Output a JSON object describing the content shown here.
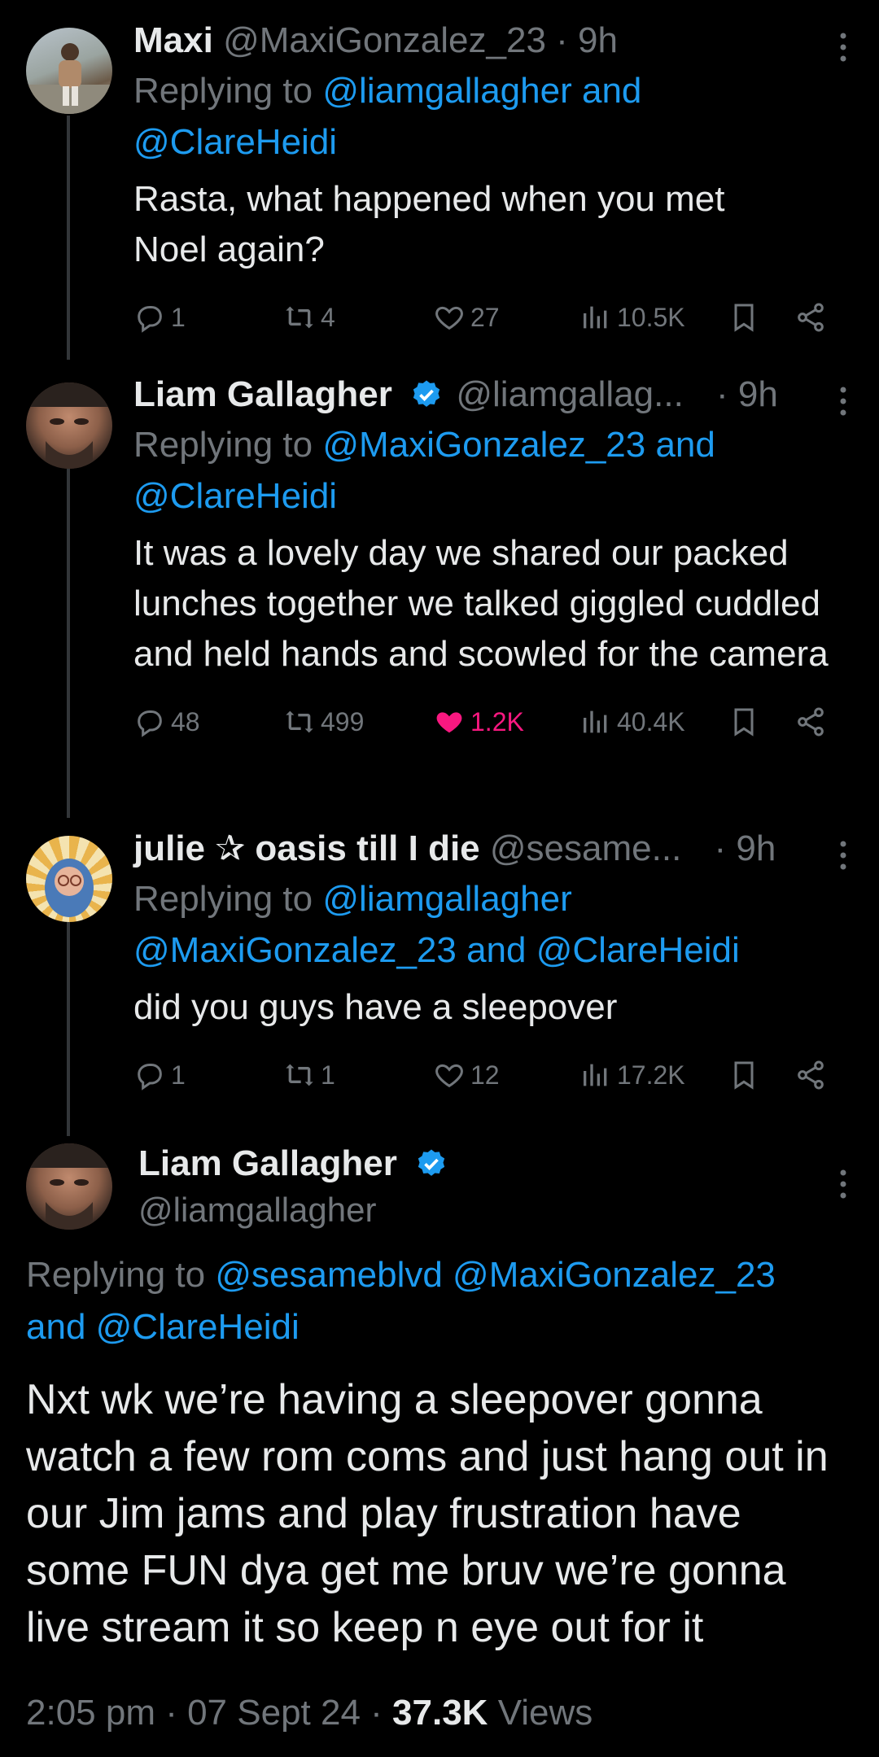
{
  "tweets": [
    {
      "name": "Maxi",
      "handle": "@MaxiGonzalez_23",
      "time": "· 9h",
      "reply_prefix": "Replying to",
      "reply_line1": "@liamgallagher and",
      "reply_line2": "@ClareHeidi",
      "text": "Rasta, what happened when you met Noel again?",
      "replies": "1",
      "retweets": "4",
      "likes": "27",
      "views": "10.5K"
    },
    {
      "name": "Liam Gallagher",
      "handle": "@liamgallag...",
      "time": "· 9h",
      "reply_prefix": "Replying to",
      "reply_line1": "@MaxiGonzalez_23 and",
      "reply_line2": "@ClareHeidi",
      "text": "It was a lovely day we shared our packed lunches together we talked giggled cuddled and held hands and scowled for the camera",
      "replies": "48",
      "retweets": "499",
      "likes": "1.2K",
      "views": "40.4K"
    },
    {
      "name": "julie ✰ oasis till I die",
      "handle": "@sesame...",
      "time": "· 9h",
      "reply_prefix": "Replying to",
      "reply_line1": "@liamgallagher",
      "reply_line2": "@MaxiGonzalez_23 and @ClareHeidi",
      "text": "did you guys have a sleepover",
      "replies": "1",
      "retweets": "1",
      "likes": "12",
      "views": "17.2K"
    }
  ],
  "main_tweet": {
    "name": "Liam Gallagher",
    "handle": "@liamgallagher",
    "reply_prefix": "Replying to",
    "reply_line1": "@sesameblvd @MaxiGonzalez_23",
    "reply_line2": "and @ClareHeidi",
    "text": "Nxt wk we’re having a sleepover gonna watch a few rom coms and just hang out in our Jim jams and play frustration have some FUN dya get me bruv we’re gonna live stream it so keep n eye out for it",
    "time": "2:05 pm · 07 Sept 24 ·",
    "views": "37.3K",
    "views_label": "Views"
  },
  "colors": {
    "accent": "#1d9bf0",
    "like": "#f91880",
    "muted": "#71767b",
    "background": "#000000"
  },
  "icons": [
    "reply-icon",
    "retweet-icon",
    "like-icon",
    "views-icon",
    "bookmark-icon",
    "share-icon",
    "verified-icon",
    "more-icon"
  ]
}
